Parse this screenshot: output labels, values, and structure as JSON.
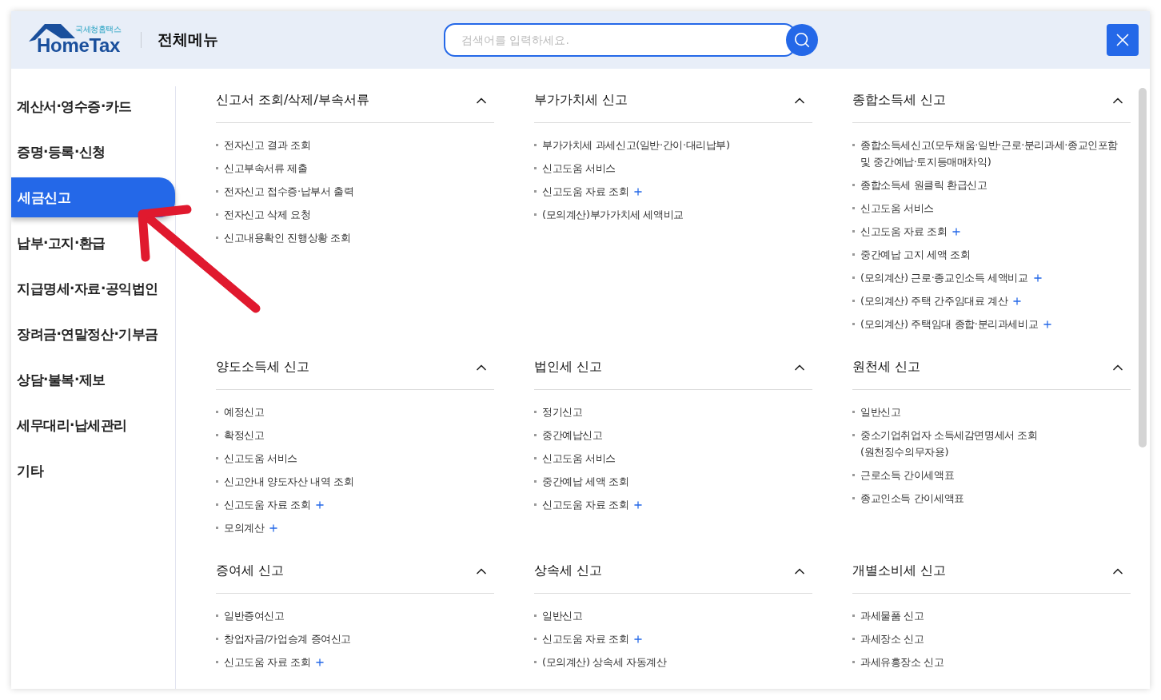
{
  "header": {
    "logo_sub": "국세청홈택스",
    "logo_main": "HomeTax",
    "title": "전체메뉴",
    "search": {
      "placeholder": "검색어를 입력하세요."
    }
  },
  "sidebar": {
    "items": [
      {
        "label": "계산서·영수증·카드",
        "selected": false
      },
      {
        "label": "증명·등록·신청",
        "selected": false
      },
      {
        "label": "세금신고",
        "selected": true
      },
      {
        "label": "납부·고지·환급",
        "selected": false
      },
      {
        "label": "지급명세·자료·공익법인",
        "selected": false
      },
      {
        "label": "장려금·연말정산·기부금",
        "selected": false
      },
      {
        "label": "상담·불복·제보",
        "selected": false
      },
      {
        "label": "세무대리·납세관리",
        "selected": false
      },
      {
        "label": "기타",
        "selected": false
      }
    ]
  },
  "sections": [
    {
      "title": "신고서 조회/삭제/부속서류",
      "expanded": true,
      "items": [
        {
          "label": "전자신고 결과 조회",
          "plus": false
        },
        {
          "label": "신고부속서류 제출",
          "plus": false
        },
        {
          "label": "전자신고 접수증·납부서 출력",
          "plus": false
        },
        {
          "label": "전자신고 삭제 요청",
          "plus": false
        },
        {
          "label": "신고내용확인 진행상황 조회",
          "plus": false
        }
      ]
    },
    {
      "title": "부가가치세 신고",
      "expanded": true,
      "items": [
        {
          "label": "부가가치세 과세신고(일반·간이·대리납부)",
          "plus": false
        },
        {
          "label": "신고도움 서비스",
          "plus": false
        },
        {
          "label": "신고도움 자료 조회",
          "plus": true
        },
        {
          "label": "(모의계산)부가가치세 세액비교",
          "plus": false
        }
      ]
    },
    {
      "title": "종합소득세 신고",
      "expanded": true,
      "items": [
        {
          "label": "종합소득세신고(모두채움·일반·근로·분리과세·종교인포함 및 중간예납·토지등매매차익)",
          "plus": false
        },
        {
          "label": "종합소득세 원클릭 환급신고",
          "plus": false
        },
        {
          "label": "신고도움 서비스",
          "plus": false
        },
        {
          "label": "신고도움 자료 조회",
          "plus": true
        },
        {
          "label": "중간예납 고지 세액 조회",
          "plus": false
        },
        {
          "label": "(모의계산) 근로·종교인소득 세액비교",
          "plus": true
        },
        {
          "label": "(모의계산) 주택 간주임대료 계산",
          "plus": true
        },
        {
          "label": "(모의계산) 주택임대 종합·분리과세비교",
          "plus": true
        }
      ]
    },
    {
      "title": "양도소득세 신고",
      "expanded": true,
      "items": [
        {
          "label": "예정신고",
          "plus": false
        },
        {
          "label": "확정신고",
          "plus": false
        },
        {
          "label": "신고도움 서비스",
          "plus": false
        },
        {
          "label": "신고안내 양도자산 내역 조회",
          "plus": false
        },
        {
          "label": "신고도움 자료 조회",
          "plus": true
        },
        {
          "label": "모의계산",
          "plus": true
        }
      ]
    },
    {
      "title": "법인세 신고",
      "expanded": true,
      "items": [
        {
          "label": "정기신고",
          "plus": false
        },
        {
          "label": "중간예납신고",
          "plus": false
        },
        {
          "label": "신고도움 서비스",
          "plus": false
        },
        {
          "label": "중간예납 세액 조회",
          "plus": false
        },
        {
          "label": "신고도움 자료 조회",
          "plus": true
        }
      ]
    },
    {
      "title": "원천세 신고",
      "expanded": true,
      "items": [
        {
          "label": "일반신고",
          "plus": false
        },
        {
          "label": "중소기업취업자 소득세감면명세서 조회\n(원천징수의무자용)",
          "plus": false
        },
        {
          "label": "근로소득 간이세액표",
          "plus": false
        },
        {
          "label": "종교인소득 간이세액표",
          "plus": false
        }
      ]
    },
    {
      "title": "증여세 신고",
      "expanded": true,
      "items": [
        {
          "label": "일반증여신고",
          "plus": false
        },
        {
          "label": "창업자금/가업승계 증여신고",
          "plus": false
        },
        {
          "label": "신고도움 자료 조회",
          "plus": true
        }
      ]
    },
    {
      "title": "상속세 신고",
      "expanded": true,
      "items": [
        {
          "label": "일반신고",
          "plus": false
        },
        {
          "label": "신고도움 자료 조회",
          "plus": true
        },
        {
          "label": "(모의계산) 상속세 자동계산",
          "plus": false
        }
      ]
    },
    {
      "title": "개별소비세 신고",
      "expanded": true,
      "items": [
        {
          "label": "과세물품 신고",
          "plus": false
        },
        {
          "label": "과세장소 신고",
          "plus": false
        },
        {
          "label": "과세유흥장소 신고",
          "plus": false
        }
      ]
    }
  ]
}
